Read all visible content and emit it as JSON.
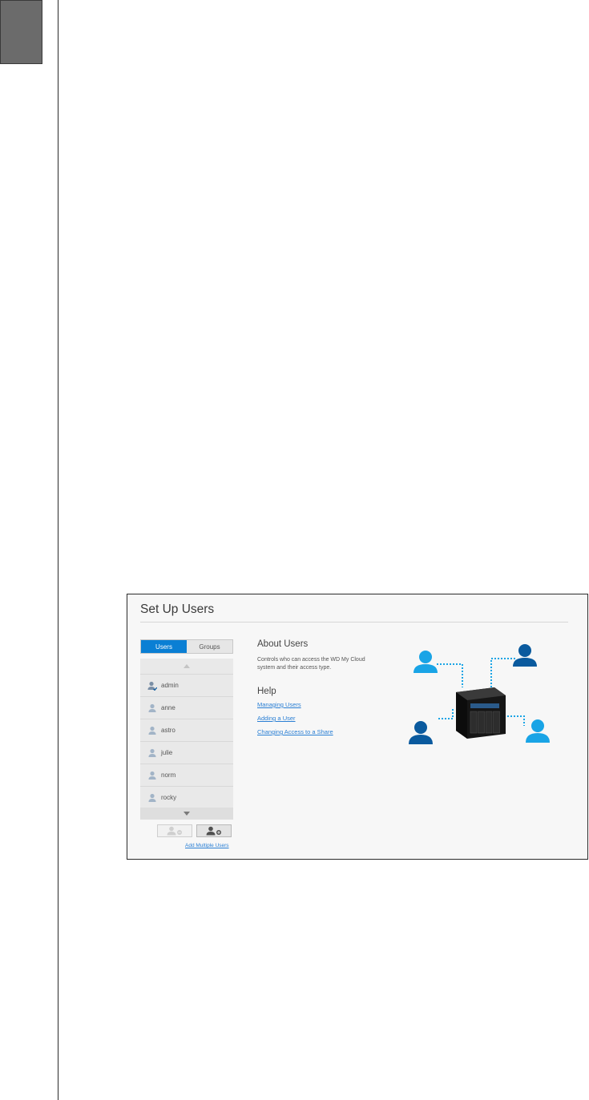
{
  "dialog": {
    "title": "Set Up Users",
    "tabs": {
      "users": "Users",
      "groups": "Groups"
    },
    "users": [
      "admin",
      "anne",
      "astro",
      "julie",
      "norm",
      "rocky"
    ],
    "add_multiple_link": "Add Multiple Users"
  },
  "about": {
    "heading": "About Users",
    "text": "Controls who can access the WD My Cloud system and their access type."
  },
  "help": {
    "heading": "Help",
    "links": [
      "Managing Users",
      "Adding a User",
      "Changing Access to a Share"
    ]
  },
  "colors": {
    "accent": "#0a7fd4",
    "link": "#2a7fd4",
    "user_light": "#19a4e6",
    "user_dark": "#0a5a9e",
    "chapter_tab": "#6b6b6b"
  },
  "icons": {
    "user_row": "user-icon",
    "remove_button": "remove-user-icon",
    "add_button": "add-user-icon",
    "diagram": "nas-device-icon"
  }
}
